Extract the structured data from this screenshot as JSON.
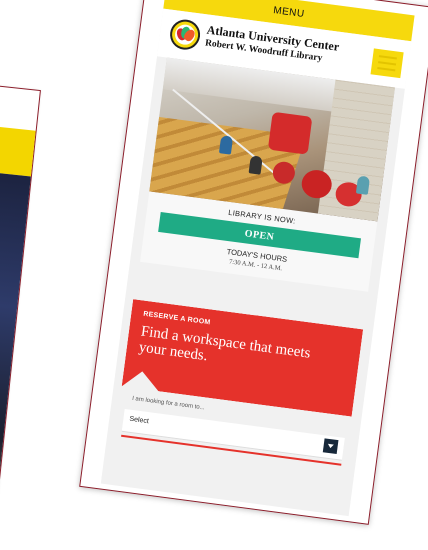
{
  "back_device": {
    "caption": ""
  },
  "menu": {
    "label": "MENU"
  },
  "header": {
    "org_line1": "Atlanta University Center",
    "org_line2": "Robert W. Woodruff Library"
  },
  "status": {
    "label": "LIBRARY IS NOW:",
    "value": "OPEN",
    "hours_title": "TODAY'S HOURS",
    "hours": "7:30 A.M. - 12 A.M."
  },
  "reserve": {
    "kicker": "RESERVE A ROOM",
    "headline": "Find a workspace that meets your needs.",
    "looking_label": "I am looking for a room to...",
    "select_value": "Select"
  },
  "colors": {
    "menu_yellow": "#f6d90d",
    "open_green": "#1fab85",
    "reserve_red": "#e5322b",
    "frame": "#8b1d2a",
    "select_button": "#17283a"
  },
  "icons": {
    "logo": "library-logo-icon",
    "hamburger": "hamburger-menu-icon",
    "dropdown": "chevron-down-icon"
  }
}
